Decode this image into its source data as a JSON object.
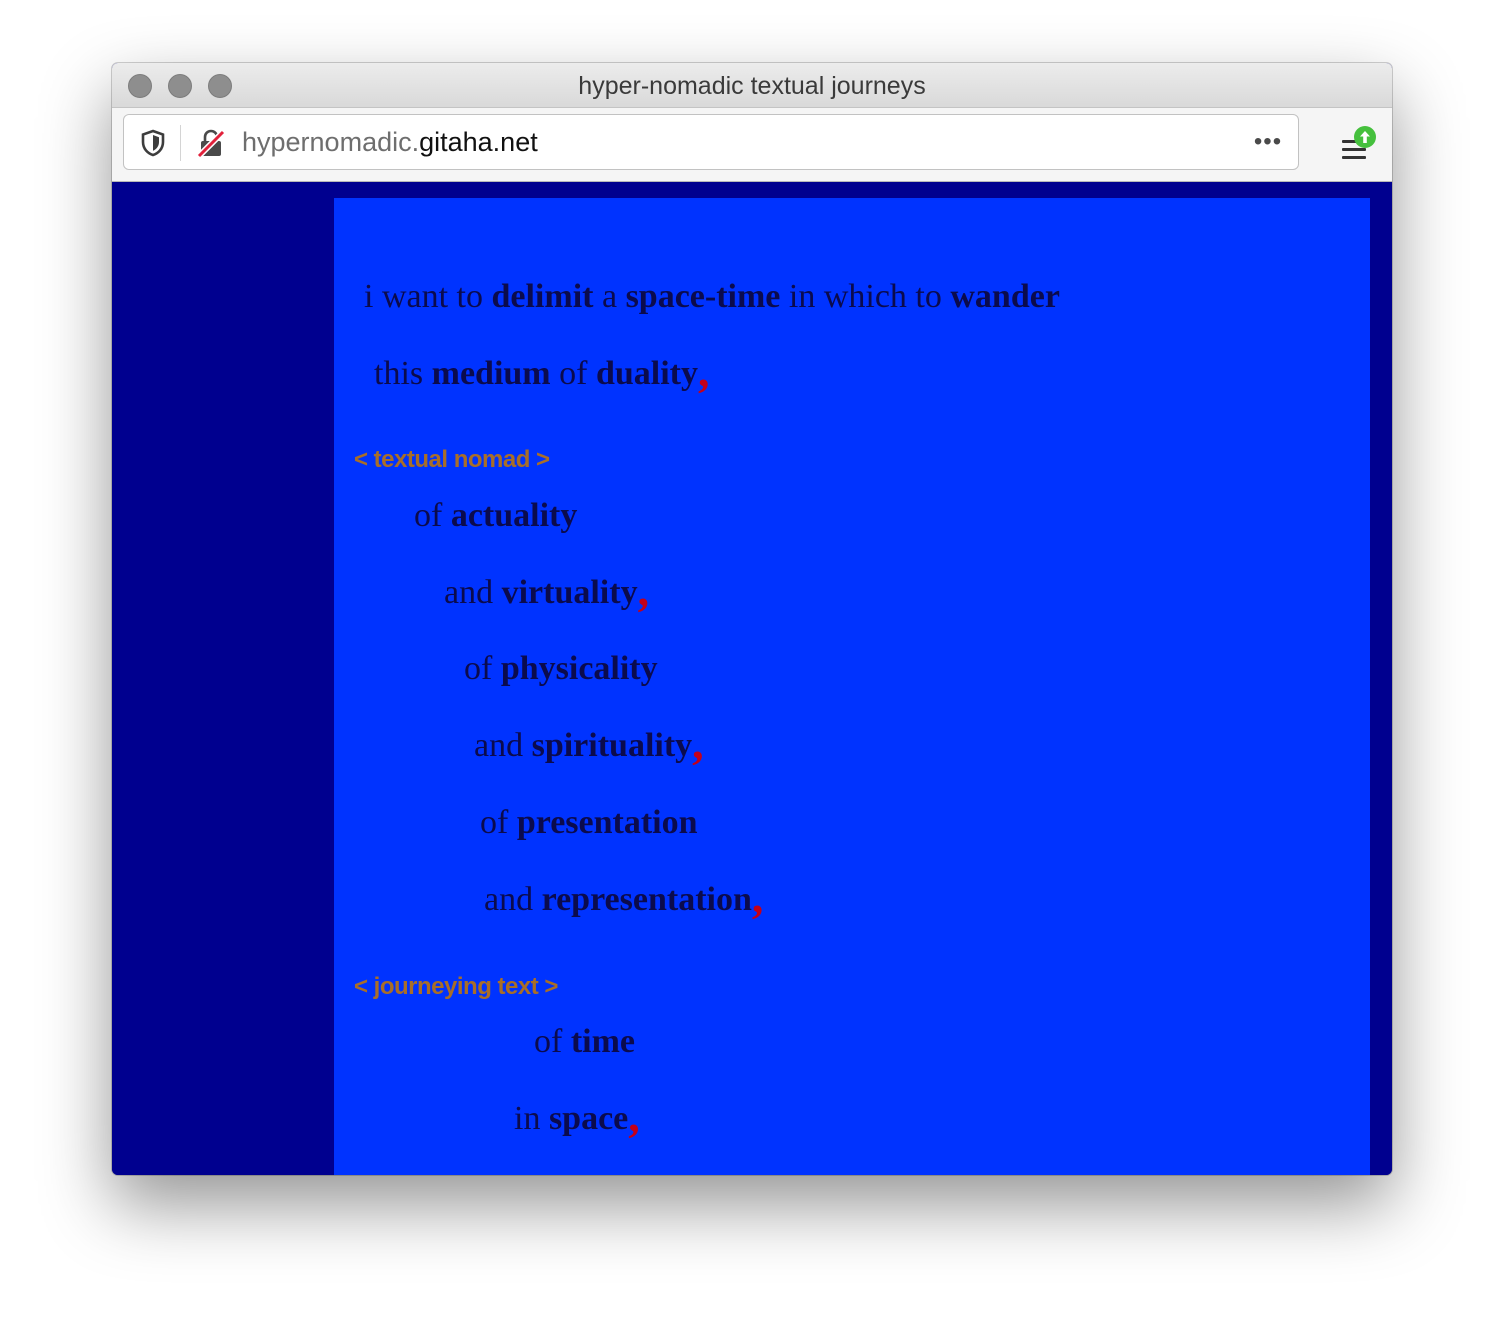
{
  "window": {
    "title": "hyper-nomadic textual journeys"
  },
  "urlbar": {
    "url_sub": "hypernomadic.",
    "url_domain": "gitaha.net",
    "more_label": "•••"
  },
  "colors": {
    "page_background": "#00008f",
    "panel_background": "#0033ff",
    "text": "#0b0b4d",
    "comma": "#c4001a",
    "tag": "#a86e28"
  },
  "poem": {
    "line1": {
      "w1": "i want to",
      "b1": "delimit",
      "w2": "a",
      "b2": "space-time",
      "w3": "in which to",
      "b3": "wander"
    },
    "line2": {
      "w1": "this",
      "b1": "medium",
      "w2": "of",
      "b2": "duality",
      "comma": ","
    },
    "tag1": "< textual nomad >",
    "line3": {
      "w1": "of",
      "b1": "actuality"
    },
    "line4": {
      "w1": "and",
      "b1": "virtuality",
      "comma": ","
    },
    "line5": {
      "w1": "of",
      "b1": "physicality"
    },
    "line6": {
      "w1": "and",
      "b1": "spirituality",
      "comma": ","
    },
    "line7": {
      "w1": "of",
      "b1": "presentation"
    },
    "line8": {
      "w1": "and",
      "b1": "representation",
      "comma": ","
    },
    "tag2": "< journeying text >",
    "line9": {
      "w1": "of",
      "b1": "time"
    },
    "line10": {
      "w1": "in",
      "b1": "space",
      "comma": ","
    }
  }
}
